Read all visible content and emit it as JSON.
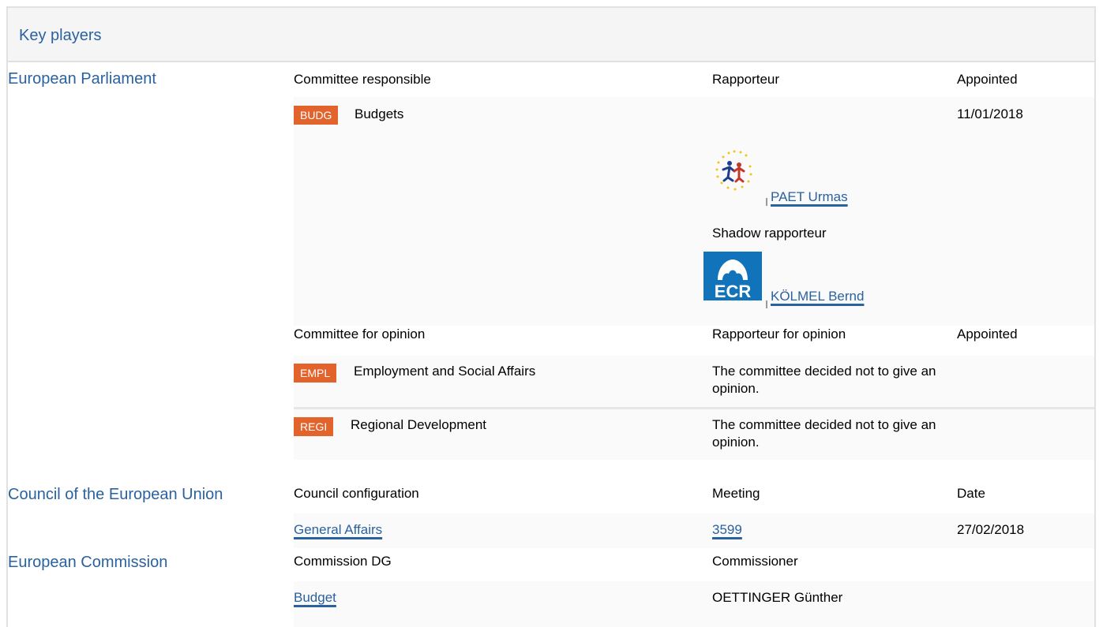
{
  "panel": {
    "title": "Key players"
  },
  "ep": {
    "institution": "European Parliament",
    "responsible_header": "Committee responsible",
    "rapporteur_header": "Rapporteur",
    "appointed_header": "Appointed",
    "budg": {
      "code": "BUDG",
      "name": "Budgets",
      "appointed": "11/01/2018",
      "rapporteur": {
        "name": "PAET Urmas",
        "logo": "renew-stars-icon"
      },
      "shadow_header": "Shadow rapporteur",
      "shadow": {
        "name": "KÖLMEL Bernd",
        "logo": "ecr-logo"
      }
    },
    "opinion_header": "Committee for opinion",
    "rapporteur_opinion_header": "Rapporteur for opinion",
    "appointed_header_2": "Appointed",
    "empl": {
      "code": "EMPL",
      "name": "Employment and Social Affairs",
      "note": "The committee decided not to give an opinion."
    },
    "regi": {
      "code": "REGI",
      "name": "Regional Development",
      "note": "The committee decided not to give an opinion."
    }
  },
  "council": {
    "institution": "Council of the European Union",
    "config_header": "Council configuration",
    "meeting_header": "Meeting",
    "date_header": "Date",
    "config": "General Affairs",
    "meeting": "3599",
    "date": "27/02/2018"
  },
  "commission": {
    "institution": "European Commission",
    "dg_header": "Commission DG",
    "commissioner_header": "Commissioner",
    "dg": "Budget",
    "commissioner": "OETTINGER Günther"
  },
  "colors": {
    "link": "#2a62a0",
    "badge": "#e2632c"
  }
}
